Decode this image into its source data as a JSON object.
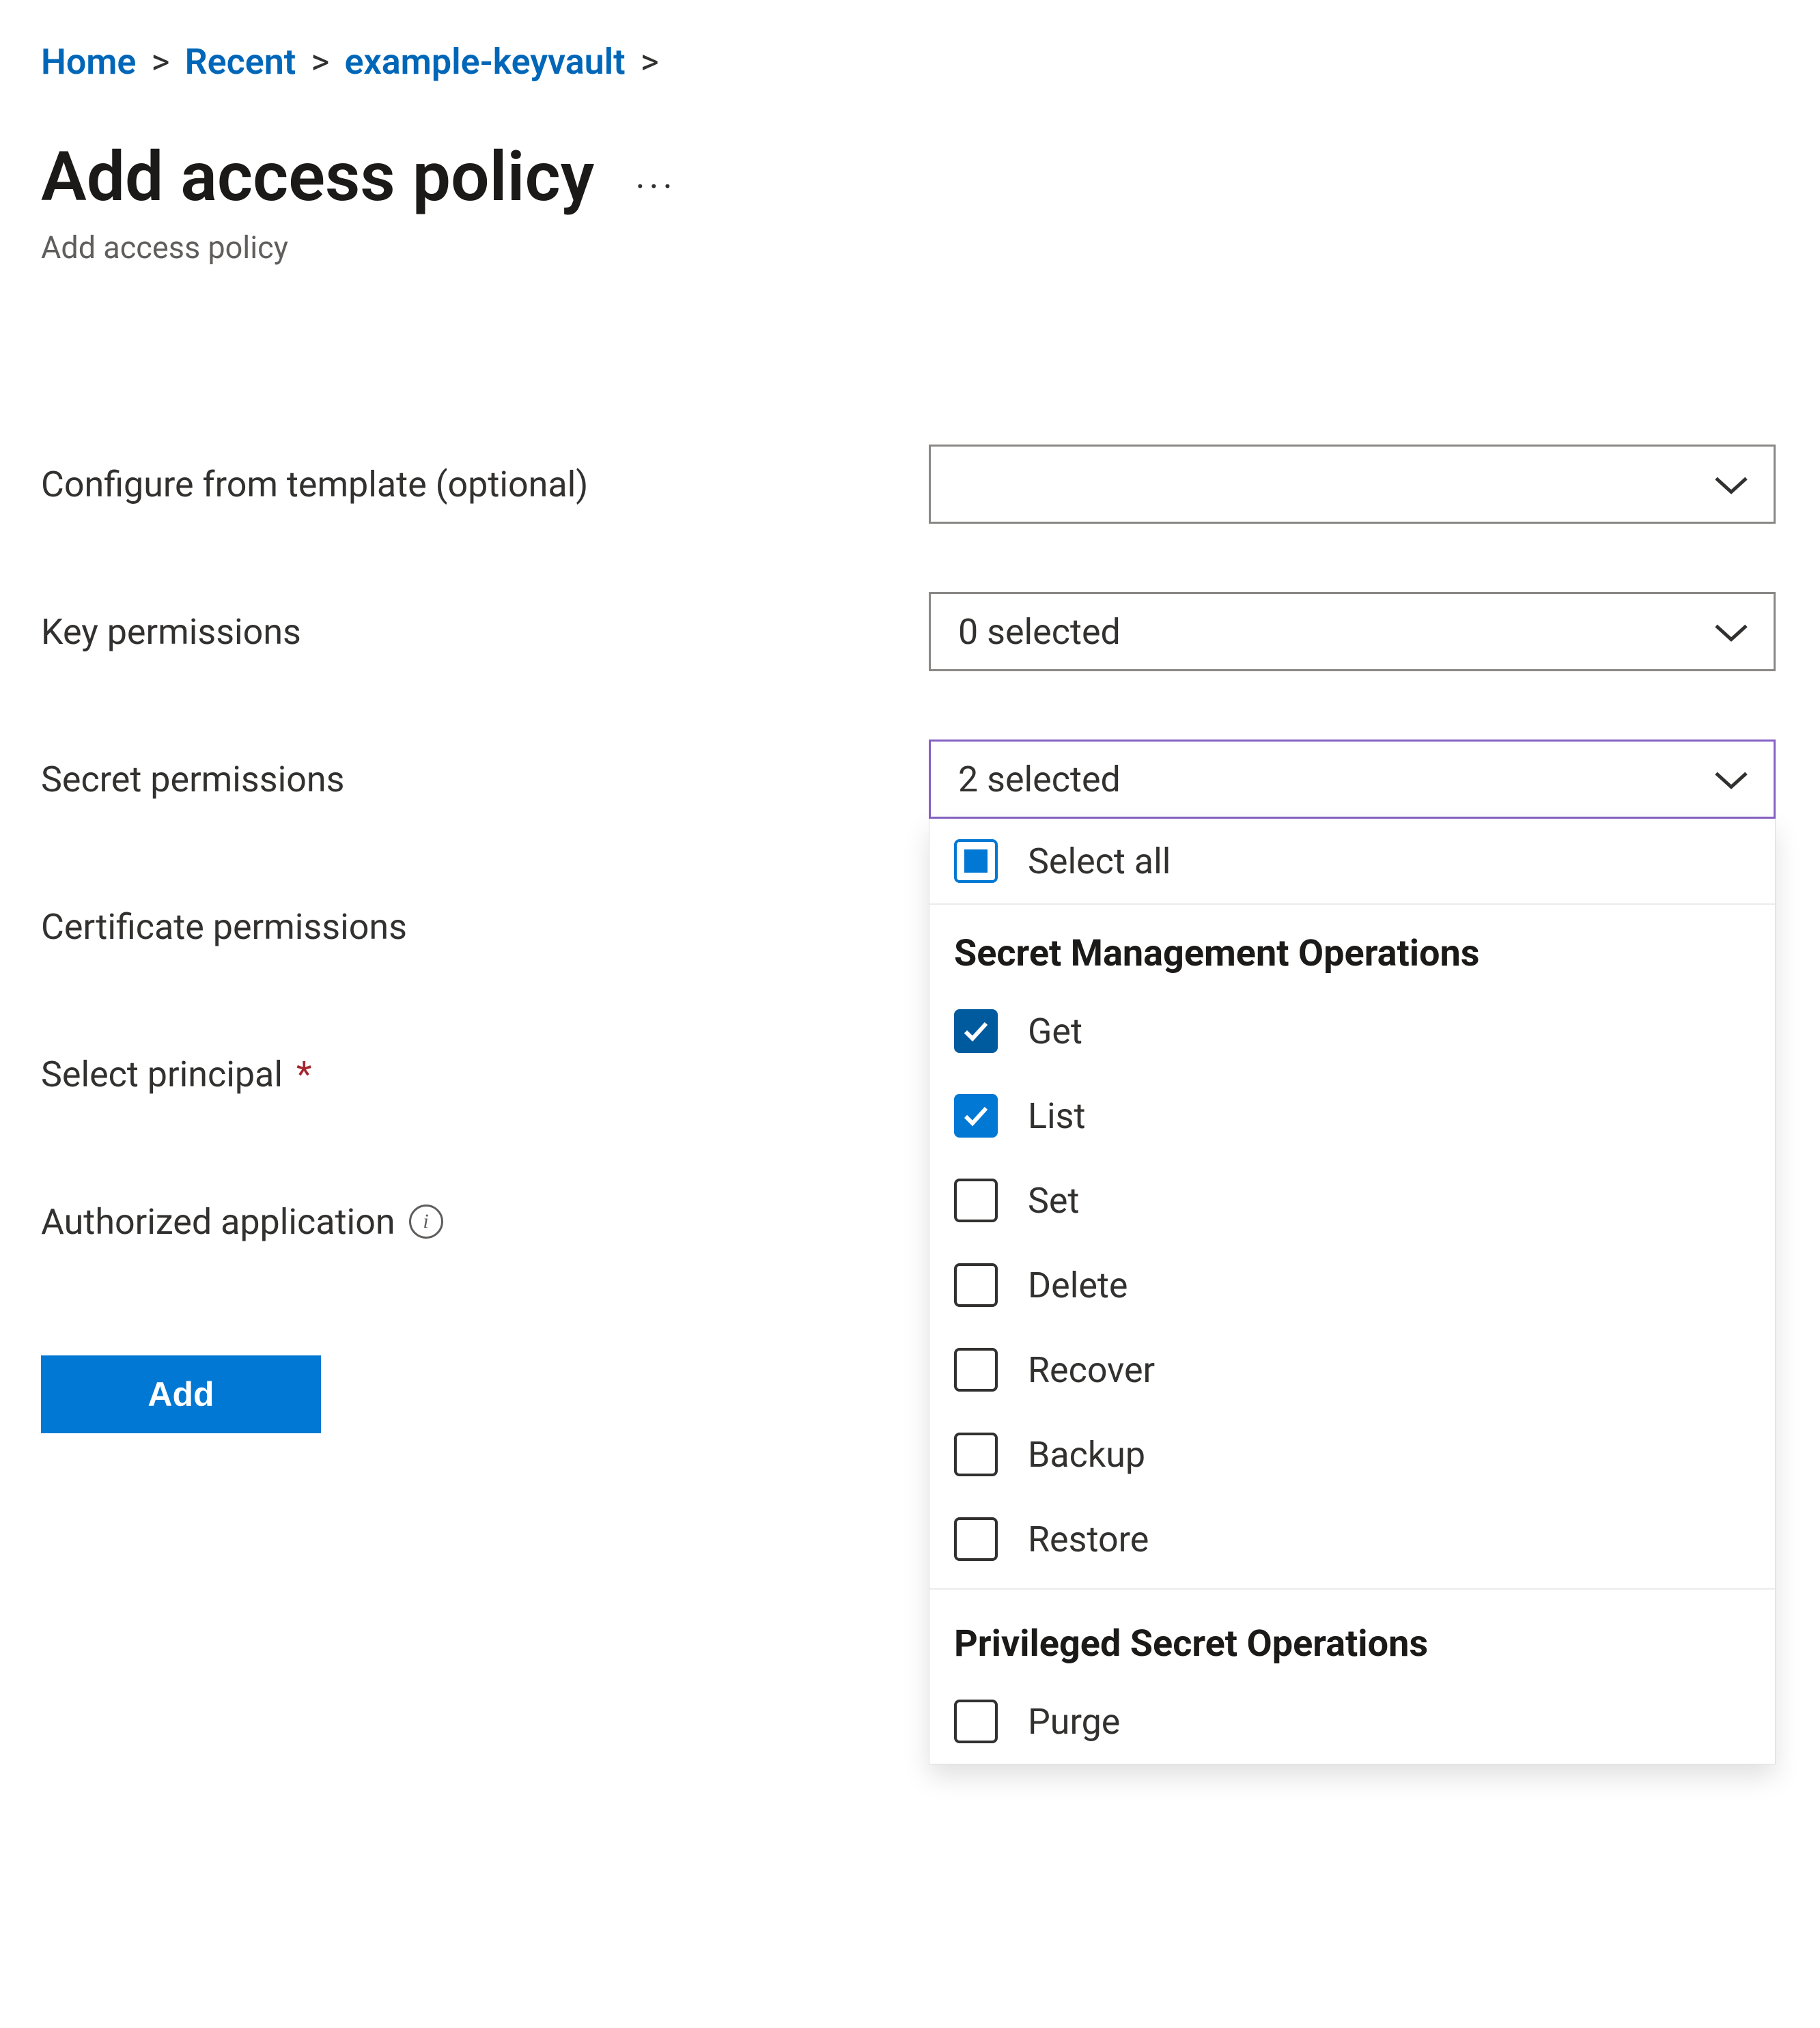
{
  "breadcrumb": {
    "items": [
      {
        "label": "Home"
      },
      {
        "label": "Recent"
      },
      {
        "label": "example-keyvault"
      }
    ],
    "separator": ">"
  },
  "header": {
    "title": "Add access policy",
    "subtitle": "Add access policy",
    "more_label": "···"
  },
  "form": {
    "template": {
      "label": "Configure from template (optional)",
      "value": ""
    },
    "key_permissions": {
      "label": "Key permissions",
      "value": "0 selected"
    },
    "secret_permissions": {
      "label": "Secret permissions",
      "value": "2 selected",
      "select_all_label": "Select all",
      "groups": [
        {
          "title": "Secret Management Operations",
          "options": [
            {
              "label": "Get",
              "checked": true
            },
            {
              "label": "List",
              "checked": true
            },
            {
              "label": "Set",
              "checked": false
            },
            {
              "label": "Delete",
              "checked": false
            },
            {
              "label": "Recover",
              "checked": false
            },
            {
              "label": "Backup",
              "checked": false
            },
            {
              "label": "Restore",
              "checked": false
            }
          ]
        },
        {
          "title": "Privileged Secret Operations",
          "options": [
            {
              "label": "Purge",
              "checked": false
            }
          ]
        }
      ]
    },
    "certificate_permissions": {
      "label": "Certificate permissions"
    },
    "select_principal": {
      "label": "Select principal",
      "required_mark": "*"
    },
    "authorized_application": {
      "label": "Authorized application"
    },
    "add_button": "Add"
  }
}
